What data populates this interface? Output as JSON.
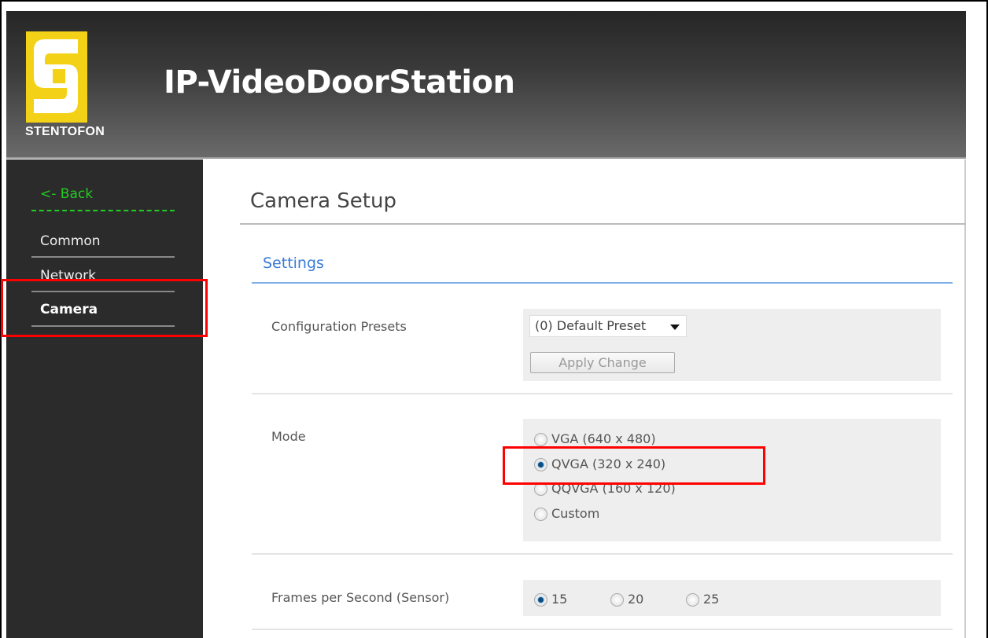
{
  "header": {
    "logo_text": "STENTOFON",
    "title": "IP-VideoDoorStation"
  },
  "sidebar": {
    "back": "<- Back",
    "items": [
      {
        "label": "Common"
      },
      {
        "label": "Network"
      },
      {
        "label": "Camera",
        "active": true
      }
    ]
  },
  "main": {
    "title": "Camera Setup",
    "section": "Settings",
    "config_presets": {
      "label": "Configuration Presets",
      "selected": "(0) Default Preset",
      "apply_label": "Apply Change"
    },
    "mode": {
      "label": "Mode",
      "options": [
        "VGA (640 x 480)",
        "QVGA (320 x 240)",
        "QQVGA (160 x 120)",
        "Custom"
      ],
      "selected": "QVGA (320 x 240)"
    },
    "fps": {
      "label": "Frames per Second (Sensor)",
      "options": [
        "15",
        "20",
        "25"
      ],
      "selected": "15"
    }
  },
  "colors": {
    "accent": "#3a7bd5",
    "back_link": "#22cc22",
    "logo": "#f3d117",
    "highlight": "#ff0000"
  }
}
